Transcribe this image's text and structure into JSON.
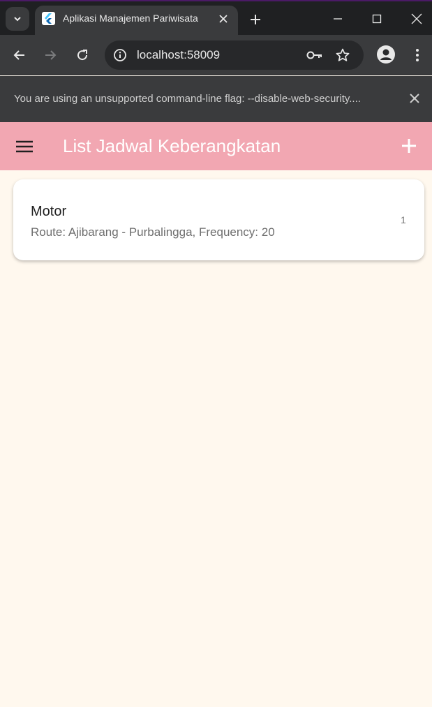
{
  "browser": {
    "tab": {
      "title": "Aplikasi Manajemen Pariwisata"
    },
    "address_bar": {
      "url": "localhost:58009"
    },
    "infobar": {
      "message": "You are using an unsupported command-line flag: --disable-web-security...."
    }
  },
  "app": {
    "appbar": {
      "title": "List Jadwal Keberangkatan"
    },
    "schedules": [
      {
        "title": "Motor",
        "subtitle": "Route: Ajibarang - Purbalingga, Frequency: 20",
        "trailing": "1"
      }
    ]
  },
  "colors": {
    "appbar": "#f2a7b2",
    "background": "#fff8ee",
    "browser_chrome": "#3a3b3d",
    "tabstrip": "#1f2022"
  },
  "icons": [
    "chevron-down-icon",
    "flutter-icon",
    "close-icon",
    "plus-icon",
    "minimize-icon",
    "maximize-icon",
    "back-arrow-icon",
    "forward-arrow-icon",
    "reload-icon",
    "info-icon",
    "key-icon",
    "star-icon",
    "profile-icon",
    "more-vert-icon",
    "menu-icon",
    "add-icon"
  ]
}
